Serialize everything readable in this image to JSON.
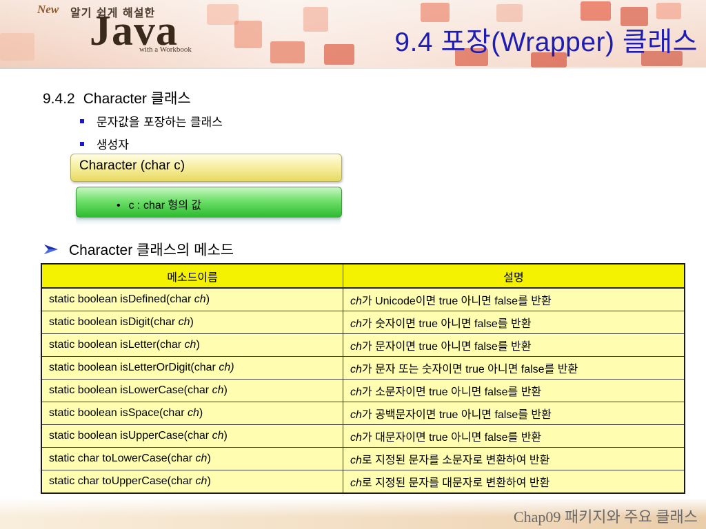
{
  "header": {
    "logo_new": "New",
    "logo_tagline": "알기 쉽게 해설한",
    "logo_java": "Java",
    "logo_workbook": "with a Workbook",
    "title": "9.4 포장(Wrapper) 클래스"
  },
  "section": {
    "number": "9.4.2",
    "title": "Character 클래스",
    "bullets": [
      "문자값을 포장하는 클래스",
      "생성자"
    ]
  },
  "constructor": {
    "signature": "Character (char c)",
    "param_bullet": "•",
    "param": "c : char 형의 값"
  },
  "methods_heading": "Character 클래스의 메소드",
  "table": {
    "headers": [
      "메소드이름",
      "설명"
    ],
    "rows": [
      {
        "method": "static boolean isDefined(char ",
        "arg": "ch",
        "close": ")",
        "desc_arg": "ch",
        "desc": "가 Unicode이면 true 아니면 false를 반환"
      },
      {
        "method": "static boolean isDigit(char ",
        "arg": "ch",
        "close": ")",
        "desc_arg": "ch",
        "desc": "가 숫자이면 true 아니면 false를 반환"
      },
      {
        "method": "static boolean isLetter(char ",
        "arg": "ch",
        "close": ")",
        "desc_arg": "ch",
        "desc": "가 문자이면 true 아니면 false를 반환"
      },
      {
        "method": "static boolean isLetterOrDigit(char ",
        "arg": "ch)",
        "close": "",
        "desc_arg": "ch",
        "desc": "가 문자 또는 숫자이면 true 아니면 false를 반환"
      },
      {
        "method": "static boolean isLowerCase(char ",
        "arg": "ch",
        "close": ")",
        "desc_arg": "ch",
        "desc": "가 소문자이면 true 아니면 false를 반환"
      },
      {
        "method": "static boolean isSpace(char ",
        "arg": "ch",
        "close": ")",
        "desc_arg": "ch",
        "desc": "가 공백문자이면 true 아니면 false를 반환"
      },
      {
        "method": "static boolean isUpperCase(char ",
        "arg": "ch",
        "close": ")",
        "desc_arg": "ch",
        "desc": "가 대문자이면 true 아니면 false를 반환"
      },
      {
        "method": "static char toLowerCase(char ",
        "arg": "ch",
        "close": ")",
        "desc_arg": "ch",
        "desc": "로 지정된 문자를 소문자로 변환하여 반환"
      },
      {
        "method": "static char toUpperCase(char ",
        "arg": "ch",
        "close": ")",
        "desc_arg": "ch",
        "desc": "로 지정된 문자를 대문자로 변환하여 반환"
      }
    ]
  },
  "footer": {
    "text": "Chap09 패키지와 주요 클래스"
  },
  "colors": {
    "title_blue": "#1d1db3",
    "table_header_yellow": "#f4f200",
    "table_cell_yellow": "#fefdb0",
    "bullet_blue": "#1818c8",
    "constructor_yellow": "#f8efa3",
    "param_green": "#6fe06b"
  },
  "icons": [
    "arrow-bullet-icon",
    "square-bullet-icon"
  ]
}
